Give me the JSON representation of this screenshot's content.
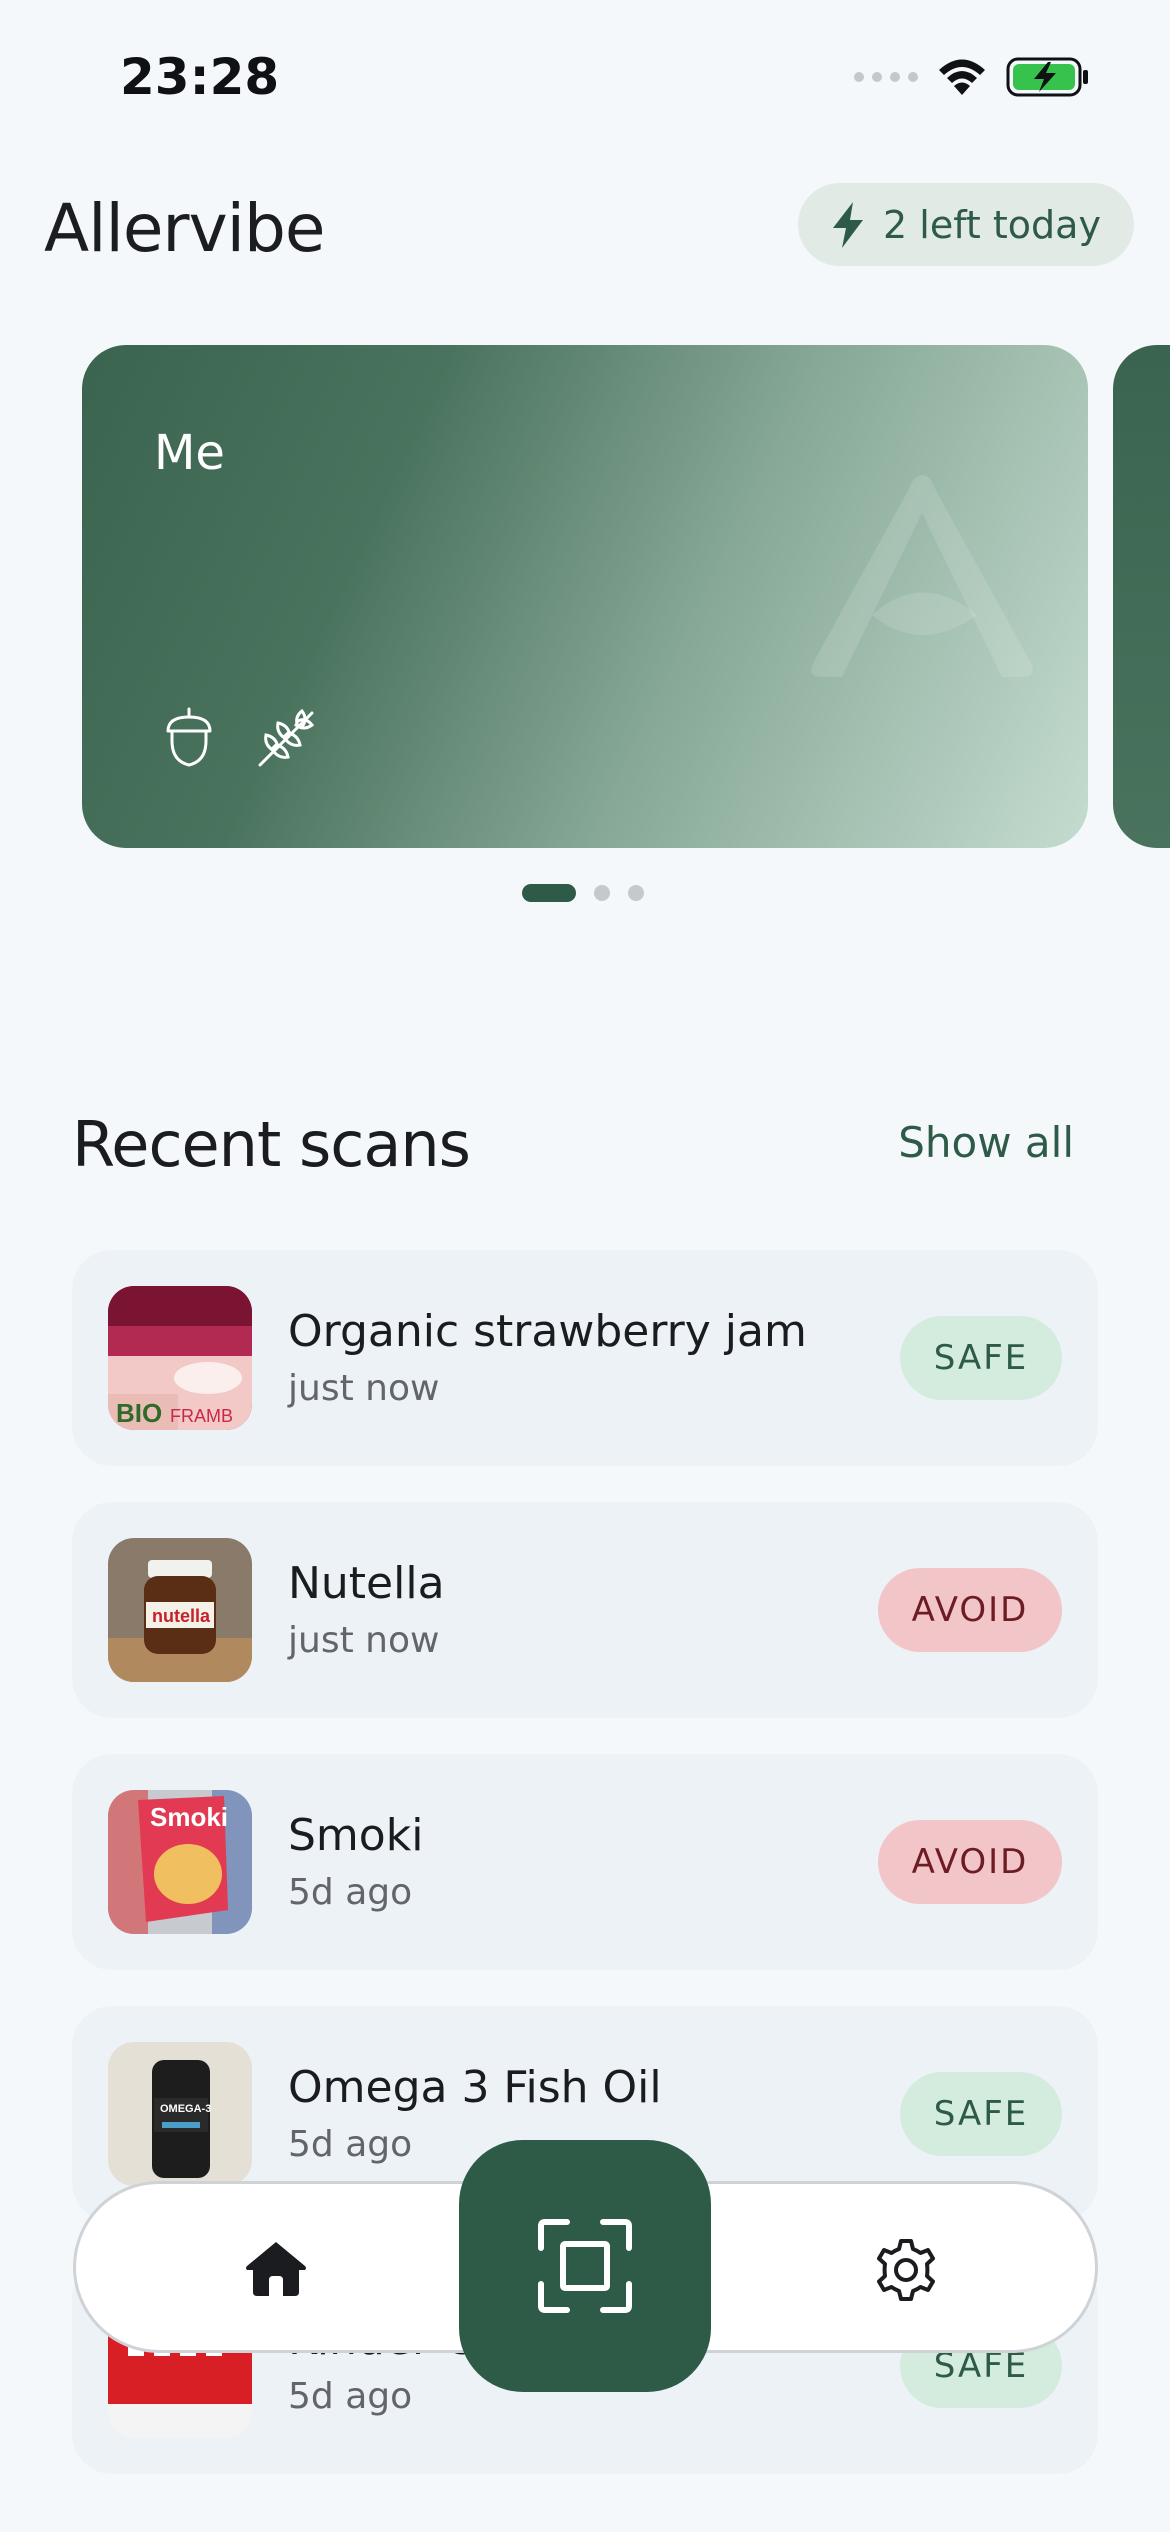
{
  "status_bar": {
    "time": "23:28"
  },
  "header": {
    "title": "Allervibe",
    "scans_left": "2 left today"
  },
  "profiles": {
    "current": {
      "name": "Me",
      "allergen_icons": [
        "acorn-icon",
        "wheat-icon"
      ]
    },
    "count": 3,
    "active_index": 0
  },
  "recent_scans": {
    "title": "Recent scans",
    "show_all": "Show all",
    "items": [
      {
        "name": "Organic strawberry jam",
        "time": "just now",
        "status": "SAFE"
      },
      {
        "name": "Nutella",
        "time": "just now",
        "status": "AVOID"
      },
      {
        "name": "Smoki",
        "time": "5d ago",
        "status": "AVOID"
      },
      {
        "name": "Omega 3 Fish Oil",
        "time": "5d ago",
        "status": "SAFE"
      },
      {
        "name": "Kinder Chocolate",
        "time": "5d ago",
        "status": "SAFE"
      }
    ]
  },
  "nav": {
    "items": [
      "home-icon",
      "scan-icon",
      "settings-icon"
    ]
  },
  "colors": {
    "brand": "#2e5a48",
    "safe_bg": "#d3ecdd",
    "avoid_bg": "#f2c6c9",
    "background": "#f5f8fb"
  }
}
